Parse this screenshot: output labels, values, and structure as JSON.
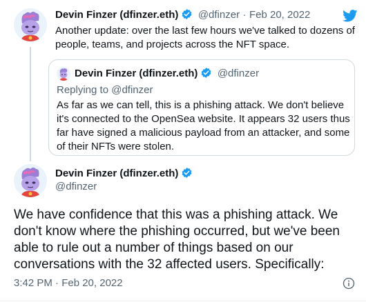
{
  "tweet1": {
    "author_name": "Devin Finzer (dfinzer.eth)",
    "handle": "@dfinzer",
    "separator": "·",
    "date": "Feb 20, 2022",
    "text": "Another update: over the last few hours we've talked to dozens of people, teams, and projects across the NFT space."
  },
  "quoted": {
    "author_name": "Devin Finzer (dfinzer.eth)",
    "handle": "@dfinzer",
    "replying_to": "Replying to @dfinzer",
    "text": "As far as we can tell, this is a phishing attack. We don't believe it's connected to the OpenSea website. It appears 32 users thus far have signed a malicious payload from an attacker, and some of their NFTs were stolen."
  },
  "tweet2": {
    "author_name": "Devin Finzer (dfinzer.eth)",
    "handle": "@dfinzer",
    "text": "We have confidence that this was a phishing attack. We don't know where the phishing occurred, but we've been able to rule out a number of things based on our conversations with the 32 affected users. Specifically:",
    "timestamp": "3:42 PM · Feb 20, 2022"
  },
  "icons": {
    "logo": "twitter-bird-icon",
    "verified": "verified-badge-icon",
    "info": "info-icon"
  },
  "colors": {
    "twitter_blue": "#1d9bf0",
    "muted": "#536471",
    "text": "#0f1419",
    "border": "#cfd9de"
  }
}
